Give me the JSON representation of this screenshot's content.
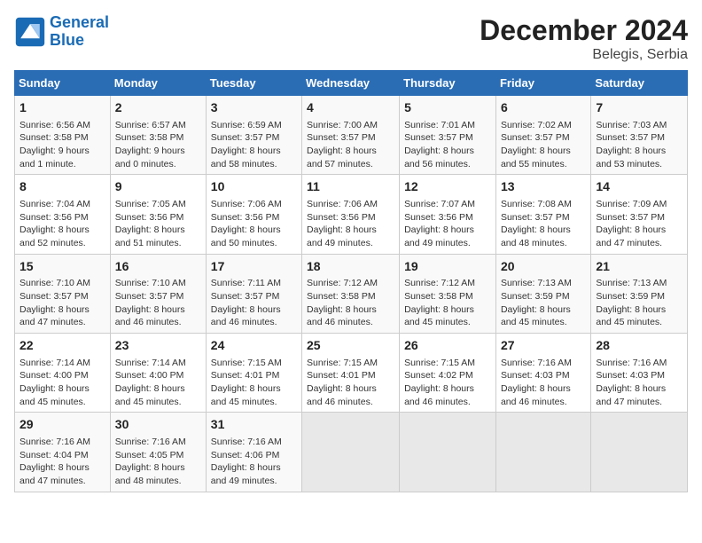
{
  "logo": {
    "line1": "General",
    "line2": "Blue"
  },
  "title": "December 2024",
  "location": "Belegis, Serbia",
  "headers": [
    "Sunday",
    "Monday",
    "Tuesday",
    "Wednesday",
    "Thursday",
    "Friday",
    "Saturday"
  ],
  "weeks": [
    [
      {
        "day": "1",
        "info": "Sunrise: 6:56 AM\nSunset: 3:58 PM\nDaylight: 9 hours and 1 minute."
      },
      {
        "day": "2",
        "info": "Sunrise: 6:57 AM\nSunset: 3:58 PM\nDaylight: 9 hours and 0 minutes."
      },
      {
        "day": "3",
        "info": "Sunrise: 6:59 AM\nSunset: 3:57 PM\nDaylight: 8 hours and 58 minutes."
      },
      {
        "day": "4",
        "info": "Sunrise: 7:00 AM\nSunset: 3:57 PM\nDaylight: 8 hours and 57 minutes."
      },
      {
        "day": "5",
        "info": "Sunrise: 7:01 AM\nSunset: 3:57 PM\nDaylight: 8 hours and 56 minutes."
      },
      {
        "day": "6",
        "info": "Sunrise: 7:02 AM\nSunset: 3:57 PM\nDaylight: 8 hours and 55 minutes."
      },
      {
        "day": "7",
        "info": "Sunrise: 7:03 AM\nSunset: 3:57 PM\nDaylight: 8 hours and 53 minutes."
      }
    ],
    [
      {
        "day": "8",
        "info": "Sunrise: 7:04 AM\nSunset: 3:56 PM\nDaylight: 8 hours and 52 minutes."
      },
      {
        "day": "9",
        "info": "Sunrise: 7:05 AM\nSunset: 3:56 PM\nDaylight: 8 hours and 51 minutes."
      },
      {
        "day": "10",
        "info": "Sunrise: 7:06 AM\nSunset: 3:56 PM\nDaylight: 8 hours and 50 minutes."
      },
      {
        "day": "11",
        "info": "Sunrise: 7:06 AM\nSunset: 3:56 PM\nDaylight: 8 hours and 49 minutes."
      },
      {
        "day": "12",
        "info": "Sunrise: 7:07 AM\nSunset: 3:56 PM\nDaylight: 8 hours and 49 minutes."
      },
      {
        "day": "13",
        "info": "Sunrise: 7:08 AM\nSunset: 3:57 PM\nDaylight: 8 hours and 48 minutes."
      },
      {
        "day": "14",
        "info": "Sunrise: 7:09 AM\nSunset: 3:57 PM\nDaylight: 8 hours and 47 minutes."
      }
    ],
    [
      {
        "day": "15",
        "info": "Sunrise: 7:10 AM\nSunset: 3:57 PM\nDaylight: 8 hours and 47 minutes."
      },
      {
        "day": "16",
        "info": "Sunrise: 7:10 AM\nSunset: 3:57 PM\nDaylight: 8 hours and 46 minutes."
      },
      {
        "day": "17",
        "info": "Sunrise: 7:11 AM\nSunset: 3:57 PM\nDaylight: 8 hours and 46 minutes."
      },
      {
        "day": "18",
        "info": "Sunrise: 7:12 AM\nSunset: 3:58 PM\nDaylight: 8 hours and 46 minutes."
      },
      {
        "day": "19",
        "info": "Sunrise: 7:12 AM\nSunset: 3:58 PM\nDaylight: 8 hours and 45 minutes."
      },
      {
        "day": "20",
        "info": "Sunrise: 7:13 AM\nSunset: 3:59 PM\nDaylight: 8 hours and 45 minutes."
      },
      {
        "day": "21",
        "info": "Sunrise: 7:13 AM\nSunset: 3:59 PM\nDaylight: 8 hours and 45 minutes."
      }
    ],
    [
      {
        "day": "22",
        "info": "Sunrise: 7:14 AM\nSunset: 4:00 PM\nDaylight: 8 hours and 45 minutes."
      },
      {
        "day": "23",
        "info": "Sunrise: 7:14 AM\nSunset: 4:00 PM\nDaylight: 8 hours and 45 minutes."
      },
      {
        "day": "24",
        "info": "Sunrise: 7:15 AM\nSunset: 4:01 PM\nDaylight: 8 hours and 45 minutes."
      },
      {
        "day": "25",
        "info": "Sunrise: 7:15 AM\nSunset: 4:01 PM\nDaylight: 8 hours and 46 minutes."
      },
      {
        "day": "26",
        "info": "Sunrise: 7:15 AM\nSunset: 4:02 PM\nDaylight: 8 hours and 46 minutes."
      },
      {
        "day": "27",
        "info": "Sunrise: 7:16 AM\nSunset: 4:03 PM\nDaylight: 8 hours and 46 minutes."
      },
      {
        "day": "28",
        "info": "Sunrise: 7:16 AM\nSunset: 4:03 PM\nDaylight: 8 hours and 47 minutes."
      }
    ],
    [
      {
        "day": "29",
        "info": "Sunrise: 7:16 AM\nSunset: 4:04 PM\nDaylight: 8 hours and 47 minutes."
      },
      {
        "day": "30",
        "info": "Sunrise: 7:16 AM\nSunset: 4:05 PM\nDaylight: 8 hours and 48 minutes."
      },
      {
        "day": "31",
        "info": "Sunrise: 7:16 AM\nSunset: 4:06 PM\nDaylight: 8 hours and 49 minutes."
      },
      null,
      null,
      null,
      null
    ]
  ]
}
